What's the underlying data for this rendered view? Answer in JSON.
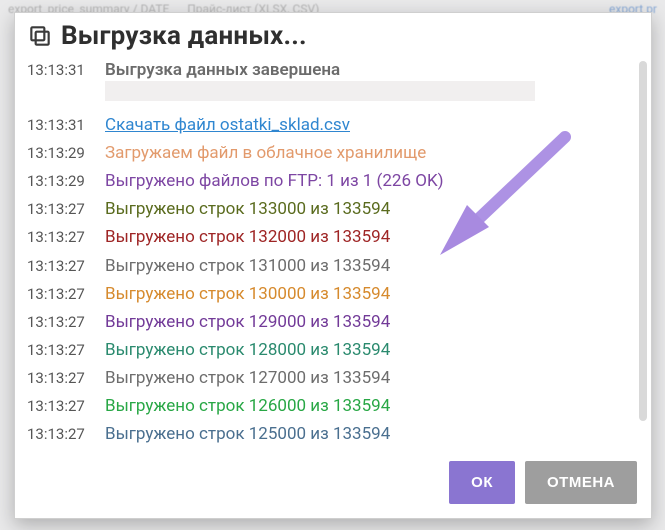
{
  "background": {
    "row_left": "export_price_summary / DATE",
    "row_mid": "Прайс-лист (XLSX, CSV)",
    "row_right": "export pr"
  },
  "dialog": {
    "title": "Выгрузка данных...",
    "header_icon": "copy",
    "buttons": {
      "ok": "ОК",
      "cancel": "ОТМЕНА"
    }
  },
  "log": [
    {
      "ts": "13:13:31",
      "text": "Выгрузка данных завершена",
      "style": "bold-dark",
      "extra": "placeholder"
    },
    {
      "ts": "13:13:31",
      "text": "Скачать файл ostatki_sklad.csv",
      "style": "link",
      "interact": true
    },
    {
      "ts": "13:13:29",
      "text": "Загружаем файл в облачное хранилище",
      "style": "salmon"
    },
    {
      "ts": "13:13:29",
      "text": "Выгружено файлов по FTP: 1 из 1 (226 OK)",
      "style": "purple"
    },
    {
      "ts": "13:13:27",
      "text": "Выгружено строк 133000 из 133594",
      "style": "olive"
    },
    {
      "ts": "13:13:27",
      "text": "Выгружено строк 132000 из 133594",
      "style": "darkred"
    },
    {
      "ts": "13:13:27",
      "text": "Выгружено строк 131000 из 133594",
      "style": "gray"
    },
    {
      "ts": "13:13:27",
      "text": "Выгружено строк 130000 из 133594",
      "style": "orange"
    },
    {
      "ts": "13:13:27",
      "text": "Выгружено строк 129000 из 133594",
      "style": "purple2"
    },
    {
      "ts": "13:13:27",
      "text": "Выгружено строк 128000 из 133594",
      "style": "teal"
    },
    {
      "ts": "13:13:27",
      "text": "Выгружено строк 127000 из 133594",
      "style": "gray"
    },
    {
      "ts": "13:13:27",
      "text": "Выгружено строк 126000 из 133594",
      "style": "green"
    },
    {
      "ts": "13:13:27",
      "text": "Выгружено строк 125000 из 133594",
      "style": "steel"
    }
  ]
}
